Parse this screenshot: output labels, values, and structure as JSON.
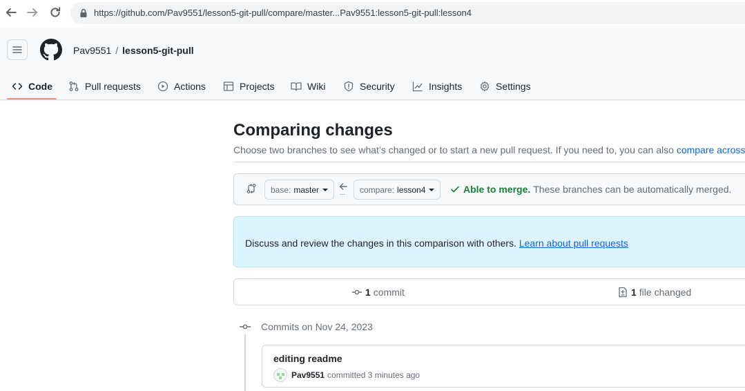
{
  "browser": {
    "url": "https://github.com/Pav9551/lesson5-git-pull/compare/master...Pav9551:lesson5-git-pull:lesson4",
    "icons": {
      "back": "back-arrow-icon",
      "forward": "forward-arrow-icon",
      "reload": "reload-icon",
      "lock": "lock-icon"
    }
  },
  "header": {
    "owner": "Pav9551",
    "separator": "/",
    "repo": "lesson5-git-pull"
  },
  "tabs": [
    {
      "label": "Code",
      "icon": "code-icon",
      "active": true
    },
    {
      "label": "Pull requests",
      "icon": "pull-request-icon"
    },
    {
      "label": "Actions",
      "icon": "play-icon"
    },
    {
      "label": "Projects",
      "icon": "table-icon"
    },
    {
      "label": "Wiki",
      "icon": "book-icon"
    },
    {
      "label": "Security",
      "icon": "shield-icon"
    },
    {
      "label": "Insights",
      "icon": "graph-icon"
    },
    {
      "label": "Settings",
      "icon": "gear-icon"
    }
  ],
  "main": {
    "title": "Comparing changes",
    "description": "Choose two branches to see what’s changed or to start a new pull request. If you need to, you can also ",
    "description_link": "compare across forks",
    "base_label": "base:",
    "base_value": "master",
    "compare_label": "compare:",
    "compare_value": "lesson4",
    "dots": "...",
    "merge_ok": "Able to merge.",
    "merge_desc": "These branches can be automatically merged.",
    "flash_text": "Discuss and review the changes in this comparison with others. ",
    "flash_link": "Learn about pull requests",
    "commit_count": "1",
    "commit_label": "commit",
    "files_count": "1",
    "files_label": "file changed",
    "commits_heading": "Commits on Nov 24, 2023",
    "commit": {
      "title": "editing readme",
      "author": "Pav9551",
      "meta": "committed 3 minutes ago"
    }
  },
  "colors": {
    "accent_link": "#0969da",
    "merge_green": "#1a7f37",
    "tab_underline": "#fd8c73",
    "flash_bg": "#ddf4ff"
  }
}
